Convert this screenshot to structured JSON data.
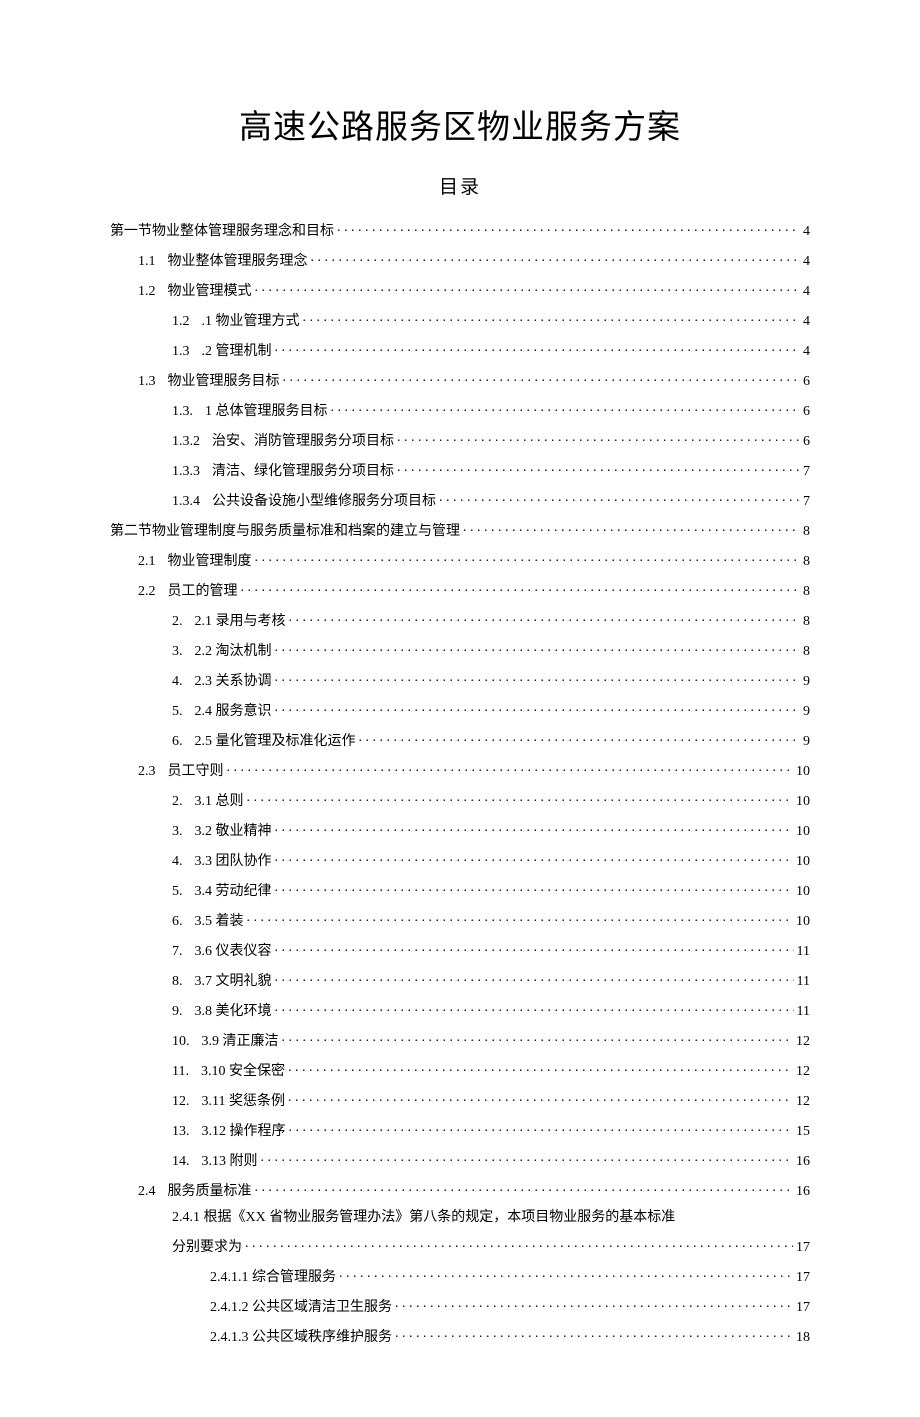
{
  "title": "高速公路服务区物业服务方案",
  "toc_heading": "目录",
  "entries": [
    {
      "indent": 0,
      "num": "",
      "label": "第一节物业整体管理服务理念和目标",
      "page": "4"
    },
    {
      "indent": 1,
      "num": "1.1",
      "label": "物业整体管理服务理念",
      "page": "4"
    },
    {
      "indent": 1,
      "num": "1.2",
      "label": "物业管理模式",
      "page": "4"
    },
    {
      "indent": 2,
      "num": "1.2",
      "label": ".1 物业管理方式",
      "page": "4"
    },
    {
      "indent": 2,
      "num": "1.3",
      "label": ".2 管理机制",
      "page": "4"
    },
    {
      "indent": 1,
      "num": "1.3",
      "label": "物业管理服务目标",
      "page": "6"
    },
    {
      "indent": 2,
      "num": "1.3.",
      "label": "1 总体管理服务目标",
      "page": "6"
    },
    {
      "indent": 2,
      "num": "1.3.2",
      "label": "治安、消防管理服务分项目标",
      "page": "6"
    },
    {
      "indent": 2,
      "num": "1.3.3",
      "label": "清洁、绿化管理服务分项目标",
      "page": "7"
    },
    {
      "indent": 2,
      "num": "1.3.4",
      "label": "公共设备设施小型维修服务分项目标",
      "page": "7"
    },
    {
      "indent": 0,
      "num": "",
      "label": "第二节物业管理制度与服务质量标准和档案的建立与管理",
      "page": "8"
    },
    {
      "indent": 1,
      "num": "2.1",
      "label": "物业管理制度",
      "page": "8"
    },
    {
      "indent": 1,
      "num": "2.2",
      "label": "员工的管理",
      "page": "8"
    },
    {
      "indent": 2,
      "num": "2.",
      "label": "2.1 录用与考核",
      "page": "8"
    },
    {
      "indent": 2,
      "num": "3.",
      "label": "2.2 淘汰机制",
      "page": "8"
    },
    {
      "indent": 2,
      "num": "4.",
      "label": "2.3 关系协调",
      "page": "9"
    },
    {
      "indent": 2,
      "num": "5.",
      "label": "2.4 服务意识",
      "page": "9"
    },
    {
      "indent": 2,
      "num": "6.",
      "label": "2.5 量化管理及标准化运作",
      "page": "9"
    },
    {
      "indent": 1,
      "num": "2.3",
      "label": "员工守则",
      "page": "10"
    },
    {
      "indent": 2,
      "num": "2.",
      "label": "3.1 总则",
      "page": "10"
    },
    {
      "indent": 2,
      "num": "3.",
      "label": "3.2 敬业精神",
      "page": "10"
    },
    {
      "indent": 2,
      "num": "4.",
      "label": "3.3 团队协作",
      "page": "10"
    },
    {
      "indent": 2,
      "num": "5.",
      "label": "3.4 劳动纪律",
      "page": "10"
    },
    {
      "indent": 2,
      "num": "6.",
      "label": "3.5 着装",
      "page": "10"
    },
    {
      "indent": 2,
      "num": "7.",
      "label": "3.6 仪表仪容",
      "page": "11"
    },
    {
      "indent": 2,
      "num": "8.",
      "label": "3.7 文明礼貌",
      "page": "11"
    },
    {
      "indent": 2,
      "num": "9.",
      "label": "3.8 美化环境",
      "page": "11"
    },
    {
      "indent": 2,
      "num": "10.",
      "label": "3.9 清正廉洁",
      "page": "12"
    },
    {
      "indent": 2,
      "num": "11.",
      "label": "3.10 安全保密",
      "page": "12"
    },
    {
      "indent": 2,
      "num": "12.",
      "label": "3.11 奖惩条例",
      "page": "12"
    },
    {
      "indent": 2,
      "num": "13.",
      "label": "3.12 操作程序",
      "page": "15"
    },
    {
      "indent": 2,
      "num": "14.",
      "label": "3.13  附则",
      "page": "16"
    },
    {
      "indent": 1,
      "num": "2.4",
      "label": "服务质量标准",
      "page": "16"
    },
    {
      "indent": 2,
      "num": "",
      "label": "2.4.1 根据《XX 省物业服务管理办法》第八条的规定，本项目物业服务的基本标准",
      "page": "",
      "nowrap": false,
      "noleader": true
    },
    {
      "indent": 2,
      "num": "",
      "label": "分别要求为",
      "page": "17"
    },
    {
      "indent": 3,
      "num": "",
      "label": "2.4.1.1 综合管理服务",
      "page": "17"
    },
    {
      "indent": 3,
      "num": "",
      "label": "2.4.1.2 公共区域清洁卫生服务",
      "page": "17"
    },
    {
      "indent": 3,
      "num": "",
      "label": "2.4.1.3 公共区域秩序维护服务",
      "page": "18"
    }
  ]
}
